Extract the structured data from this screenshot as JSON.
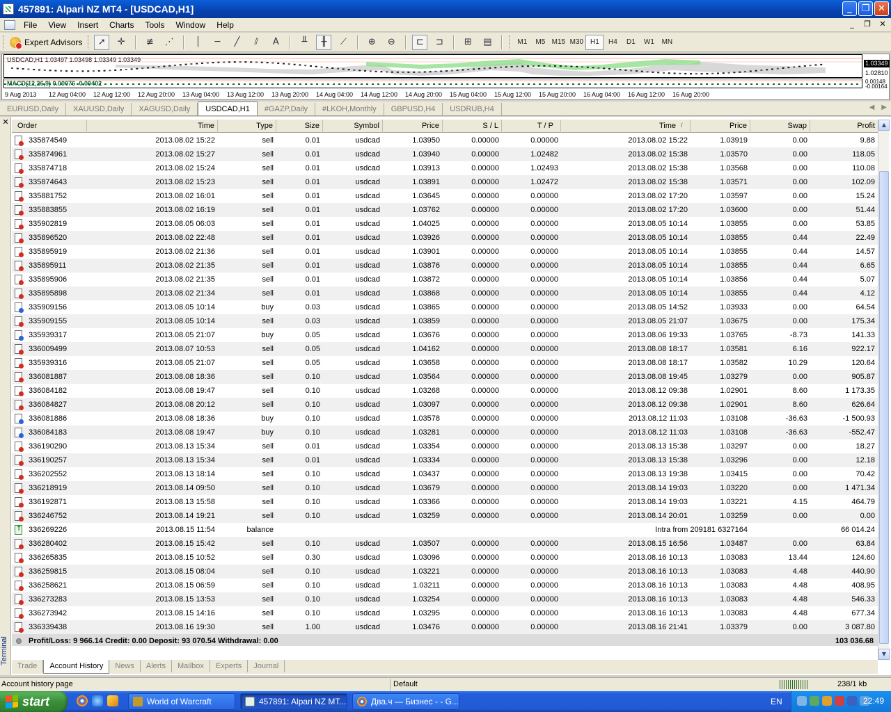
{
  "window": {
    "title": "457891: Alpari NZ MT4 - [USDCAD,H1]"
  },
  "menu": {
    "items": [
      "File",
      "View",
      "Insert",
      "Charts",
      "Tools",
      "Window",
      "Help"
    ]
  },
  "toolbar": {
    "expert_advisors_label": "Expert Advisors",
    "timeframes": [
      "M1",
      "M5",
      "M15",
      "M30",
      "H1",
      "H4",
      "D1",
      "W1",
      "MN"
    ],
    "active_timeframe": "H1",
    "text_tool_label": "A"
  },
  "chart": {
    "info": "USDCAD,H1  1.03497 1.03498 1.03349 1.03349",
    "sub_info": "MACD(12,26,9) 0.00076 -0.00402",
    "price_current": "1.03349",
    "price_mid": "1.02810",
    "sub_scale_top": "0.00148",
    "sub_scale_bottom": "-0.00164",
    "time_labels": [
      "9 Aug 2013",
      "12 Aug 04:00",
      "12 Aug 12:00",
      "12 Aug 20:00",
      "13 Aug 04:00",
      "13 Aug 12:00",
      "13 Aug 20:00",
      "14 Aug 04:00",
      "14 Aug 12:00",
      "14 Aug 20:00",
      "15 Aug 04:00",
      "15 Aug 12:00",
      "15 Aug 20:00",
      "16 Aug 04:00",
      "16 Aug 12:00",
      "16 Aug 20:00"
    ],
    "colors": {
      "bull_area": "#8fe08f",
      "bear_area": "#c0c0c0",
      "macd": "#0b6b38",
      "grid": "#ffb09a"
    }
  },
  "chart_tabs": {
    "items": [
      "EURUSD,Daily",
      "XAUUSD,Daily",
      "XAGUSD,Daily",
      "USDCAD,H1",
      "#GAZP,Daily",
      "#LKOH,Monthly",
      "GBPUSD,H4",
      "USDRUB,H4"
    ],
    "active": "USDCAD,H1"
  },
  "terminal": {
    "side_label": "Terminal",
    "columns": {
      "order": "Order",
      "open_time": "Time",
      "type": "Type",
      "size": "Size",
      "symbol": "Symbol",
      "open_price": "Price",
      "sl": "S / L",
      "tp": "T / P",
      "close_time": "Time",
      "sort_mark": "/",
      "close_price": "Price",
      "swap": "Swap",
      "profit": "Profit"
    },
    "rows": [
      {
        "order": "335874549",
        "open_time": "2013.08.02 15:22",
        "type": "sell",
        "size": "0.01",
        "symbol": "usdcad",
        "open_price": "1.03950",
        "sl": "0.00000",
        "tp": "0.00000",
        "close_time": "2013.08.02 15:22",
        "close_price": "1.03919",
        "swap": "0.00",
        "profit": "9.88"
      },
      {
        "order": "335874961",
        "open_time": "2013.08.02 15:27",
        "type": "sell",
        "size": "0.01",
        "symbol": "usdcad",
        "open_price": "1.03940",
        "sl": "0.00000",
        "tp": "1.02482",
        "close_time": "2013.08.02 15:38",
        "close_price": "1.03570",
        "swap": "0.00",
        "profit": "118.05"
      },
      {
        "order": "335874718",
        "open_time": "2013.08.02 15:24",
        "type": "sell",
        "size": "0.01",
        "symbol": "usdcad",
        "open_price": "1.03913",
        "sl": "0.00000",
        "tp": "1.02493",
        "close_time": "2013.08.02 15:38",
        "close_price": "1.03568",
        "swap": "0.00",
        "profit": "110.08"
      },
      {
        "order": "335874643",
        "open_time": "2013.08.02 15:23",
        "type": "sell",
        "size": "0.01",
        "symbol": "usdcad",
        "open_price": "1.03891",
        "sl": "0.00000",
        "tp": "1.02472",
        "close_time": "2013.08.02 15:38",
        "close_price": "1.03571",
        "swap": "0.00",
        "profit": "102.09"
      },
      {
        "order": "335881752",
        "open_time": "2013.08.02 16:01",
        "type": "sell",
        "size": "0.01",
        "symbol": "usdcad",
        "open_price": "1.03645",
        "sl": "0.00000",
        "tp": "0.00000",
        "close_time": "2013.08.02 17:20",
        "close_price": "1.03597",
        "swap": "0.00",
        "profit": "15.24"
      },
      {
        "order": "335883855",
        "open_time": "2013.08.02 16:19",
        "type": "sell",
        "size": "0.01",
        "symbol": "usdcad",
        "open_price": "1.03762",
        "sl": "0.00000",
        "tp": "0.00000",
        "close_time": "2013.08.02 17:20",
        "close_price": "1.03600",
        "swap": "0.00",
        "profit": "51.44"
      },
      {
        "order": "335902819",
        "open_time": "2013.08.05 06:03",
        "type": "sell",
        "size": "0.01",
        "symbol": "usdcad",
        "open_price": "1.04025",
        "sl": "0.00000",
        "tp": "0.00000",
        "close_time": "2013.08.05 10:14",
        "close_price": "1.03855",
        "swap": "0.00",
        "profit": "53.85"
      },
      {
        "order": "335896520",
        "open_time": "2013.08.02 22:48",
        "type": "sell",
        "size": "0.01",
        "symbol": "usdcad",
        "open_price": "1.03926",
        "sl": "0.00000",
        "tp": "0.00000",
        "close_time": "2013.08.05 10:14",
        "close_price": "1.03855",
        "swap": "0.44",
        "profit": "22.49"
      },
      {
        "order": "335895919",
        "open_time": "2013.08.02 21:36",
        "type": "sell",
        "size": "0.01",
        "symbol": "usdcad",
        "open_price": "1.03901",
        "sl": "0.00000",
        "tp": "0.00000",
        "close_time": "2013.08.05 10:14",
        "close_price": "1.03855",
        "swap": "0.44",
        "profit": "14.57"
      },
      {
        "order": "335895911",
        "open_time": "2013.08.02 21:35",
        "type": "sell",
        "size": "0.01",
        "symbol": "usdcad",
        "open_price": "1.03876",
        "sl": "0.00000",
        "tp": "0.00000",
        "close_time": "2013.08.05 10:14",
        "close_price": "1.03855",
        "swap": "0.44",
        "profit": "6.65"
      },
      {
        "order": "335895906",
        "open_time": "2013.08.02 21:35",
        "type": "sell",
        "size": "0.01",
        "symbol": "usdcad",
        "open_price": "1.03872",
        "sl": "0.00000",
        "tp": "0.00000",
        "close_time": "2013.08.05 10:14",
        "close_price": "1.03856",
        "swap": "0.44",
        "profit": "5.07"
      },
      {
        "order": "335895898",
        "open_time": "2013.08.02 21:34",
        "type": "sell",
        "size": "0.01",
        "symbol": "usdcad",
        "open_price": "1.03868",
        "sl": "0.00000",
        "tp": "0.00000",
        "close_time": "2013.08.05 10:14",
        "close_price": "1.03855",
        "swap": "0.44",
        "profit": "4.12"
      },
      {
        "order": "335909156",
        "open_time": "2013.08.05 10:14",
        "type": "buy",
        "size": "0.03",
        "symbol": "usdcad",
        "open_price": "1.03865",
        "sl": "0.00000",
        "tp": "0.00000",
        "close_time": "2013.08.05 14:52",
        "close_price": "1.03933",
        "swap": "0.00",
        "profit": "64.54"
      },
      {
        "order": "335909155",
        "open_time": "2013.08.05 10:14",
        "type": "sell",
        "size": "0.03",
        "symbol": "usdcad",
        "open_price": "1.03859",
        "sl": "0.00000",
        "tp": "0.00000",
        "close_time": "2013.08.05 21:07",
        "close_price": "1.03675",
        "swap": "0.00",
        "profit": "175.34"
      },
      {
        "order": "335939317",
        "open_time": "2013.08.05 21:07",
        "type": "buy",
        "size": "0.05",
        "symbol": "usdcad",
        "open_price": "1.03676",
        "sl": "0.00000",
        "tp": "0.00000",
        "close_time": "2013.08.06 19:33",
        "close_price": "1.03765",
        "swap": "-8.73",
        "profit": "141.33"
      },
      {
        "order": "336009499",
        "open_time": "2013.08.07 10:53",
        "type": "sell",
        "size": "0.05",
        "symbol": "usdcad",
        "open_price": "1.04162",
        "sl": "0.00000",
        "tp": "0.00000",
        "close_time": "2013.08.08 18:17",
        "close_price": "1.03581",
        "swap": "6.16",
        "profit": "922.17"
      },
      {
        "order": "335939316",
        "open_time": "2013.08.05 21:07",
        "type": "sell",
        "size": "0.05",
        "symbol": "usdcad",
        "open_price": "1.03658",
        "sl": "0.00000",
        "tp": "0.00000",
        "close_time": "2013.08.08 18:17",
        "close_price": "1.03582",
        "swap": "10.29",
        "profit": "120.64"
      },
      {
        "order": "336081887",
        "open_time": "2013.08.08 18:36",
        "type": "sell",
        "size": "0.10",
        "symbol": "usdcad",
        "open_price": "1.03564",
        "sl": "0.00000",
        "tp": "0.00000",
        "close_time": "2013.08.08 19:45",
        "close_price": "1.03279",
        "swap": "0.00",
        "profit": "905.87"
      },
      {
        "order": "336084182",
        "open_time": "2013.08.08 19:47",
        "type": "sell",
        "size": "0.10",
        "symbol": "usdcad",
        "open_price": "1.03268",
        "sl": "0.00000",
        "tp": "0.00000",
        "close_time": "2013.08.12 09:38",
        "close_price": "1.02901",
        "swap": "8.60",
        "profit": "1 173.35"
      },
      {
        "order": "336084827",
        "open_time": "2013.08.08 20:12",
        "type": "sell",
        "size": "0.10",
        "symbol": "usdcad",
        "open_price": "1.03097",
        "sl": "0.00000",
        "tp": "0.00000",
        "close_time": "2013.08.12 09:38",
        "close_price": "1.02901",
        "swap": "8.60",
        "profit": "626.64"
      },
      {
        "order": "336081886",
        "open_time": "2013.08.08 18:36",
        "type": "buy",
        "size": "0.10",
        "symbol": "usdcad",
        "open_price": "1.03578",
        "sl": "0.00000",
        "tp": "0.00000",
        "close_time": "2013.08.12 11:03",
        "close_price": "1.03108",
        "swap": "-36.63",
        "profit": "-1 500.93"
      },
      {
        "order": "336084183",
        "open_time": "2013.08.08 19:47",
        "type": "buy",
        "size": "0.10",
        "symbol": "usdcad",
        "open_price": "1.03281",
        "sl": "0.00000",
        "tp": "0.00000",
        "close_time": "2013.08.12 11:03",
        "close_price": "1.03108",
        "swap": "-36.63",
        "profit": "-552.47"
      },
      {
        "order": "336190290",
        "open_time": "2013.08.13 15:34",
        "type": "sell",
        "size": "0.01",
        "symbol": "usdcad",
        "open_price": "1.03354",
        "sl": "0.00000",
        "tp": "0.00000",
        "close_time": "2013.08.13 15:38",
        "close_price": "1.03297",
        "swap": "0.00",
        "profit": "18.27"
      },
      {
        "order": "336190257",
        "open_time": "2013.08.13 15:34",
        "type": "sell",
        "size": "0.01",
        "symbol": "usdcad",
        "open_price": "1.03334",
        "sl": "0.00000",
        "tp": "0.00000",
        "close_time": "2013.08.13 15:38",
        "close_price": "1.03296",
        "swap": "0.00",
        "profit": "12.18"
      },
      {
        "order": "336202552",
        "open_time": "2013.08.13 18:14",
        "type": "sell",
        "size": "0.10",
        "symbol": "usdcad",
        "open_price": "1.03437",
        "sl": "0.00000",
        "tp": "0.00000",
        "close_time": "2013.08.13 19:38",
        "close_price": "1.03415",
        "swap": "0.00",
        "profit": "70.42"
      },
      {
        "order": "336218919",
        "open_time": "2013.08.14 09:50",
        "type": "sell",
        "size": "0.10",
        "symbol": "usdcad",
        "open_price": "1.03679",
        "sl": "0.00000",
        "tp": "0.00000",
        "close_time": "2013.08.14 19:03",
        "close_price": "1.03220",
        "swap": "0.00",
        "profit": "1 471.34"
      },
      {
        "order": "336192871",
        "open_time": "2013.08.13 15:58",
        "type": "sell",
        "size": "0.10",
        "symbol": "usdcad",
        "open_price": "1.03366",
        "sl": "0.00000",
        "tp": "0.00000",
        "close_time": "2013.08.14 19:03",
        "close_price": "1.03221",
        "swap": "4.15",
        "profit": "464.79"
      },
      {
        "order": "336246752",
        "open_time": "2013.08.14 19:21",
        "type": "sell",
        "size": "0.10",
        "symbol": "usdcad",
        "open_price": "1.03259",
        "sl": "0.00000",
        "tp": "0.00000",
        "close_time": "2013.08.14 20:01",
        "close_price": "1.03259",
        "swap": "0.00",
        "profit": "0.00"
      },
      {
        "order": "336269226",
        "open_time": "2013.08.15 11:54",
        "type": "balance",
        "size": "",
        "symbol": "",
        "open_price": "",
        "sl": "",
        "tp": "",
        "close_time": "",
        "close_price": "Intra from 209181 6327164",
        "swap": "",
        "profit": "66 014.24"
      },
      {
        "order": "336280402",
        "open_time": "2013.08.15 15:42",
        "type": "sell",
        "size": "0.10",
        "symbol": "usdcad",
        "open_price": "1.03507",
        "sl": "0.00000",
        "tp": "0.00000",
        "close_time": "2013.08.15 16:56",
        "close_price": "1.03487",
        "swap": "0.00",
        "profit": "63.84"
      },
      {
        "order": "336265835",
        "open_time": "2013.08.15 10:52",
        "type": "sell",
        "size": "0.30",
        "symbol": "usdcad",
        "open_price": "1.03096",
        "sl": "0.00000",
        "tp": "0.00000",
        "close_time": "2013.08.16 10:13",
        "close_price": "1.03083",
        "swap": "13.44",
        "profit": "124.60"
      },
      {
        "order": "336259815",
        "open_time": "2013.08.15 08:04",
        "type": "sell",
        "size": "0.10",
        "symbol": "usdcad",
        "open_price": "1.03221",
        "sl": "0.00000",
        "tp": "0.00000",
        "close_time": "2013.08.16 10:13",
        "close_price": "1.03083",
        "swap": "4.48",
        "profit": "440.90"
      },
      {
        "order": "336258621",
        "open_time": "2013.08.15 06:59",
        "type": "sell",
        "size": "0.10",
        "symbol": "usdcad",
        "open_price": "1.03211",
        "sl": "0.00000",
        "tp": "0.00000",
        "close_time": "2013.08.16 10:13",
        "close_price": "1.03083",
        "swap": "4.48",
        "profit": "408.95"
      },
      {
        "order": "336273283",
        "open_time": "2013.08.15 13:53",
        "type": "sell",
        "size": "0.10",
        "symbol": "usdcad",
        "open_price": "1.03254",
        "sl": "0.00000",
        "tp": "0.00000",
        "close_time": "2013.08.16 10:13",
        "close_price": "1.03083",
        "swap": "4.48",
        "profit": "546.33"
      },
      {
        "order": "336273942",
        "open_time": "2013.08.15 14:16",
        "type": "sell",
        "size": "0.10",
        "symbol": "usdcad",
        "open_price": "1.03295",
        "sl": "0.00000",
        "tp": "0.00000",
        "close_time": "2013.08.16 10:13",
        "close_price": "1.03083",
        "swap": "4.48",
        "profit": "677.34"
      },
      {
        "order": "336339438",
        "open_time": "2013.08.16 19:30",
        "type": "sell",
        "size": "1.00",
        "symbol": "usdcad",
        "open_price": "1.03476",
        "sl": "0.00000",
        "tp": "0.00000",
        "close_time": "2013.08.16 21:41",
        "close_price": "1.03379",
        "swap": "0.00",
        "profit": "3 087.80"
      }
    ],
    "summary": {
      "text": "Profit/Loss: 9 966.14  Credit: 0.00  Deposit: 93 070.54  Withdrawal: 0.00",
      "total": "103 036.68"
    },
    "tabs": [
      "Trade",
      "Account History",
      "News",
      "Alerts",
      "Mailbox",
      "Experts",
      "Journal"
    ],
    "active_tab": "Account History"
  },
  "statusbar": {
    "hint": "Account history page",
    "profile": "Default",
    "traffic": "238/1 kb"
  },
  "taskbar": {
    "start_label": "start",
    "tasks": [
      {
        "label": "World of Warcraft",
        "icon_color": "#c49a2a"
      },
      {
        "label": "457891: Alpari NZ MT...",
        "icon_color": "#6a8a6a"
      },
      {
        "label": "Два.ч — Бизнес - - G...",
        "icon_color": "#d94a38"
      }
    ],
    "active_task": 1,
    "language": "EN",
    "clock": "22:49"
  }
}
